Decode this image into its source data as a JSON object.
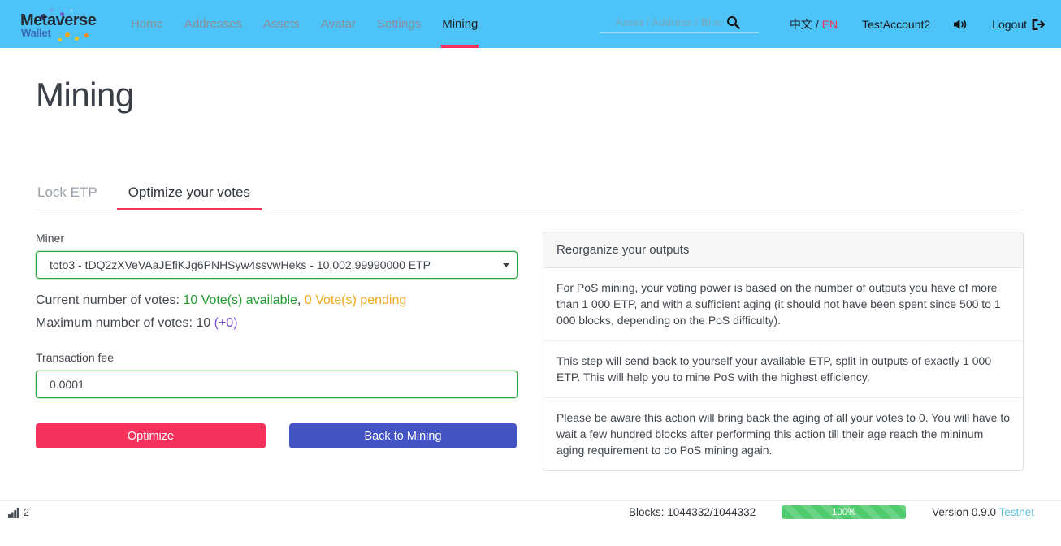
{
  "navbar": {
    "brand": {
      "main": "Metaverse",
      "sub": "Wallet"
    },
    "links": [
      {
        "label": "Home",
        "active": false
      },
      {
        "label": "Addresses",
        "active": false
      },
      {
        "label": "Assets",
        "active": false
      },
      {
        "label": "Avatar",
        "active": false
      },
      {
        "label": "Settings",
        "active": false
      },
      {
        "label": "Mining",
        "active": true
      }
    ],
    "search": {
      "placeholder": "Asset / Address / Block / Tra",
      "value": ""
    },
    "language": {
      "zh": "中文",
      "sep": " / ",
      "en": "EN"
    },
    "account": "TestAccount2",
    "logout": "Logout",
    "accent": "#f5325b",
    "background": "#4ec3f7"
  },
  "page": {
    "title": "Mining"
  },
  "tabs": [
    {
      "label": "Lock ETP",
      "active": false
    },
    {
      "label": "Optimize your votes",
      "active": true
    }
  ],
  "form": {
    "miner_label": "Miner",
    "miner_value": "toto3 - tDQ2zXVeVAaJEfiKJg6PNHSyw4ssvwHeks - 10,002.99990000 ETP",
    "current_votes_label": "Current number of votes: ",
    "votes_available": "10 Vote(s) available",
    "votes_separator": ", ",
    "votes_pending": "0 Vote(s) pending",
    "max_votes_label": "Maximum number of votes: 10 ",
    "max_votes_extra": "(+0)",
    "fee_label": "Transaction fee",
    "fee_value": "0.0001",
    "optimize_button": "Optimize",
    "back_button": "Back to Mining",
    "colors": {
      "available": "#1f9d2f",
      "pending": "#f0a81e",
      "extra": "#7c4dde",
      "optimize": "#f5325b",
      "back": "#4353c4",
      "input_border": "#27a839"
    }
  },
  "panel": {
    "title": "Reorganize your outputs",
    "items": [
      "For PoS mining, your voting power is based on the number of outputs you have of more than 1 000 ETP, and with a sufficient aging (it should not have been spent since 500 to 1 000 blocks, depending on the PoS difficulty).",
      "This step will send back to yourself your available ETP, split in outputs of exactly 1 000 ETP. This will help you to mine PoS with the highest efficiency.",
      "Please be aware this action will bring back the aging of all your votes to 0. You will have to wait a few hundred blocks after performing this action till their age reach the mininum aging requirement to do PoS mining again."
    ]
  },
  "footer": {
    "peers": "2",
    "blocks": "Blocks: 1044332/1044332",
    "progress_label": "100%",
    "progress_percent": 100,
    "version": "Version 0.9.0 ",
    "network": "Testnet",
    "progress_color": "#4fcb6d",
    "network_color": "#5bc0de"
  }
}
